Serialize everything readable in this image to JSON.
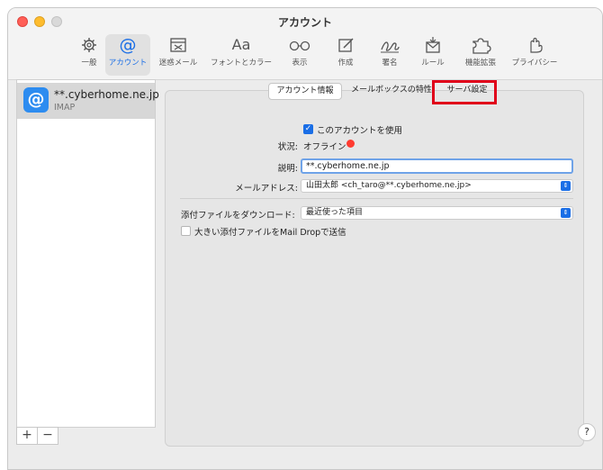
{
  "window": {
    "title": "アカウント"
  },
  "toolbar": {
    "items": [
      {
        "label": "一般",
        "icon": "gear-icon"
      },
      {
        "label": "アカウント",
        "icon": "at-icon"
      },
      {
        "label": "迷惑メール",
        "icon": "junk-mail-icon"
      },
      {
        "label": "フォントとカラー",
        "icon": "font-icon",
        "glyph": "Aa"
      },
      {
        "label": "表示",
        "icon": "glasses-icon"
      },
      {
        "label": "作成",
        "icon": "compose-icon"
      },
      {
        "label": "署名",
        "icon": "signature-icon"
      },
      {
        "label": "ルール",
        "icon": "rules-icon"
      },
      {
        "label": "機能拡張",
        "icon": "puzzle-icon"
      },
      {
        "label": "プライバシー",
        "icon": "hand-icon"
      }
    ]
  },
  "sidebar": {
    "account": {
      "name": "**.cyberhome.ne.jp",
      "type": "IMAP",
      "icon_glyph": "@"
    },
    "add_label": "+",
    "remove_label": "−"
  },
  "tabs": [
    "アカウント情報",
    "メールボックスの特性",
    "サーバ設定"
  ],
  "form": {
    "enable_label": "このアカウントを使用",
    "status_label": "状況:",
    "status_value": "オフライン",
    "description_label": "説明:",
    "description_value": "**.cyberhome.ne.jp",
    "email_label": "メールアドレス:",
    "email_value": "山田太郎 <ch_taro@**.cyberhome.ne.jp>",
    "download_label": "添付ファイルをダウンロード:",
    "download_value": "最近使った項目",
    "maildrop_label": "大きい添付ファイルをMail Dropで送信"
  },
  "help_label": "?",
  "colors": {
    "accent": "#1a6ee6",
    "status_offline": "#ff3b30",
    "highlight_box": "#e0001a"
  }
}
